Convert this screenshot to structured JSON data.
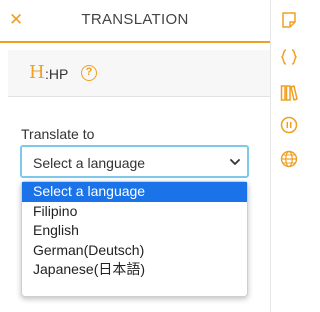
{
  "header": {
    "close_label": "✕",
    "title": "TRANSLATION"
  },
  "reference": {
    "logo": "H",
    "text": ":HP",
    "help_label": "?"
  },
  "translate": {
    "label": "Translate to",
    "selected": "Select a language",
    "options": [
      "Select a language",
      "Filipino",
      "English",
      "German(Deutsch)",
      "Japanese(日本語)"
    ]
  },
  "sidebar": {
    "icons": [
      "note-icon",
      "braces-icon",
      "library-icon",
      "pause-circle-icon",
      "globe-icon"
    ]
  },
  "colors": {
    "accent": "#f0a020",
    "focus": "#7ec8ea",
    "selected_bg": "#1a73e8"
  }
}
